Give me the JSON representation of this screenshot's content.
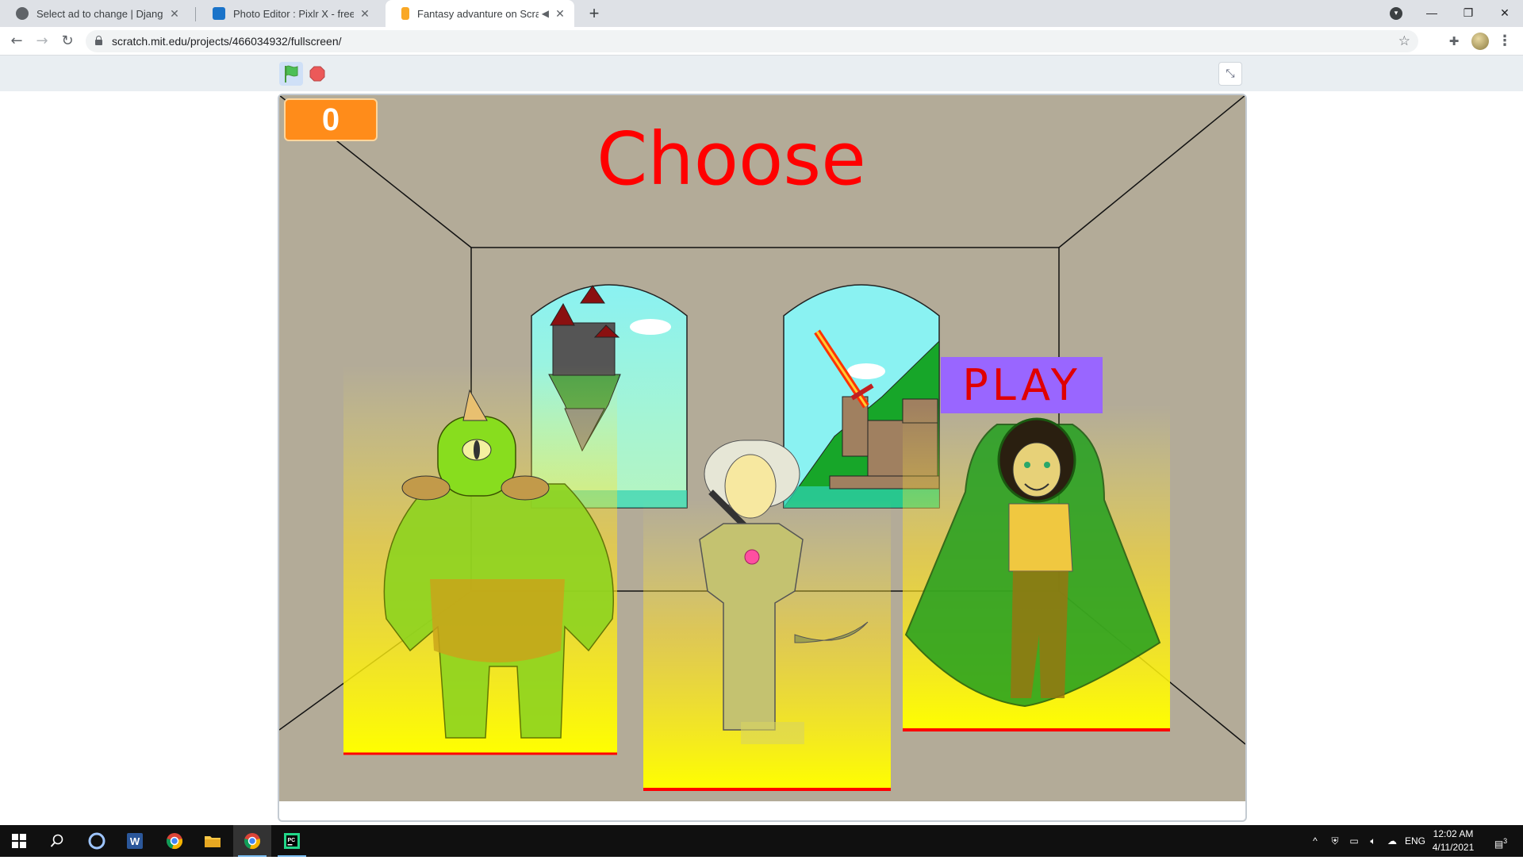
{
  "browser": {
    "tabs": [
      {
        "title": "Select ad to change | Django site",
        "active": false
      },
      {
        "title": "Photo Editor : Pixlr X - free image",
        "active": false
      },
      {
        "title": "Fantasy advanture on Scratch",
        "active": true
      }
    ],
    "new_tab_symbol": "+",
    "url": "scratch.mit.edu/projects/466034932/fullscreen/"
  },
  "scratch": {
    "score": "0",
    "heading": "Choose",
    "play_label": "PLAY",
    "characters": [
      "cyclops-ogre",
      "elf-swordsman",
      "hooded-ranger"
    ],
    "colors": {
      "heading": "#ff0000",
      "score_bg": "#ff8c1a",
      "play_bg": "#9966ff",
      "play_text": "#e00000",
      "stage_bg": "#b3ab98"
    }
  },
  "taskbar": {
    "language": "ENG",
    "time": "12:02 AM",
    "date": "4/11/2021",
    "notifications": "3"
  }
}
